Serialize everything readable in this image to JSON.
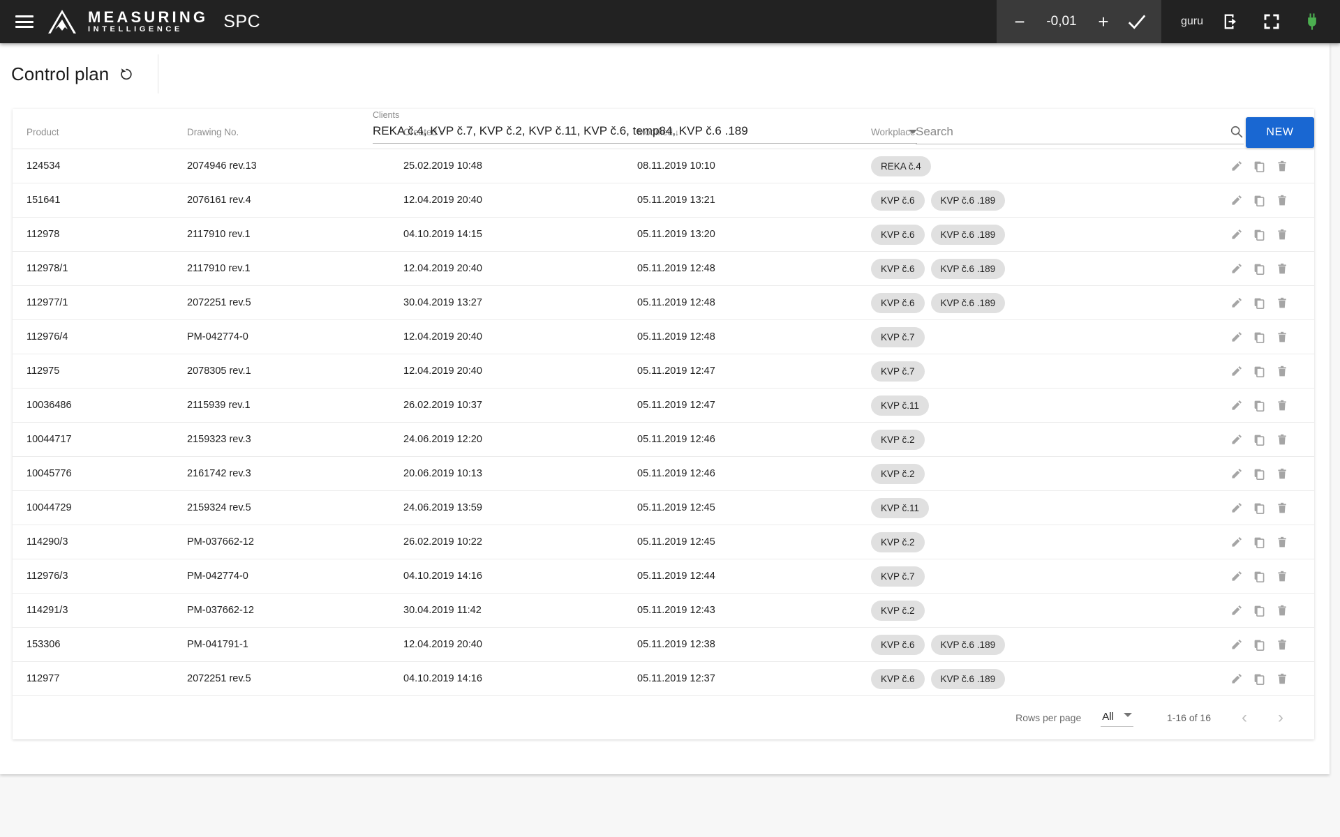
{
  "appbar": {
    "menu_icon": "hamburger-icon",
    "brand_line1": "MEASURING",
    "brand_line2": "INTELLIGENCE",
    "app_subtitle": "SPC",
    "zoom": {
      "minus_label": "−",
      "value": "-0,01",
      "plus_label": "+",
      "confirm_icon": "check-icon"
    },
    "user": "guru",
    "logout_icon": "logout-icon",
    "fullscreen_icon": "fullscreen-icon",
    "connection_icon": "plug-icon",
    "connection_color": "#4caf50",
    "background": "#222222",
    "zoom_group_background": "#3a3a3a"
  },
  "toolbar": {
    "title": "Control plan",
    "refresh_icon": "restore-icon",
    "clients": {
      "label": "Clients",
      "value": "REKA č.4, KVP č.7, KVP č.2, KVP č.11, KVP č.6, temp84, KVP č.6 .189"
    },
    "search": {
      "placeholder": "Search",
      "value": "",
      "icon": "search-icon"
    },
    "new_button": "NEW",
    "accent_color": "#1967d2"
  },
  "table": {
    "columns": [
      {
        "key": "product",
        "label": "Product",
        "sort": ""
      },
      {
        "key": "drawing",
        "label": "Drawing No.",
        "sort": ""
      },
      {
        "key": "created",
        "label": "Created",
        "sort": "↑"
      },
      {
        "key": "modified",
        "label": "Modified",
        "sort": "↓"
      },
      {
        "key": "workplace",
        "label": "Workplace",
        "sort": ""
      }
    ],
    "row_actions": [
      "edit-icon",
      "copy-icon",
      "delete-icon"
    ],
    "rows": [
      {
        "product": "124534",
        "drawing": "2074946 rev.13",
        "created": "25.02.2019 10:48",
        "modified": "08.11.2019 10:10",
        "workplace": [
          "REKA č.4"
        ]
      },
      {
        "product": "151641",
        "drawing": "2076161 rev.4",
        "created": "12.04.2019 20:40",
        "modified": "05.11.2019 13:21",
        "workplace": [
          "KVP č.6",
          "KVP č.6 .189"
        ]
      },
      {
        "product": "112978",
        "drawing": "2117910 rev.1",
        "created": "04.10.2019 14:15",
        "modified": "05.11.2019 13:20",
        "workplace": [
          "KVP č.6",
          "KVP č.6 .189"
        ]
      },
      {
        "product": "112978/1",
        "drawing": "2117910 rev.1",
        "created": "12.04.2019 20:40",
        "modified": "05.11.2019 12:48",
        "workplace": [
          "KVP č.6",
          "KVP č.6 .189"
        ]
      },
      {
        "product": "112977/1",
        "drawing": "2072251 rev.5",
        "created": "30.04.2019 13:27",
        "modified": "05.11.2019 12:48",
        "workplace": [
          "KVP č.6",
          "KVP č.6 .189"
        ]
      },
      {
        "product": "112976/4",
        "drawing": "PM-042774-0",
        "created": "12.04.2019 20:40",
        "modified": "05.11.2019 12:48",
        "workplace": [
          "KVP č.7"
        ]
      },
      {
        "product": "112975",
        "drawing": "2078305 rev.1",
        "created": "12.04.2019 20:40",
        "modified": "05.11.2019 12:47",
        "workplace": [
          "KVP č.7"
        ]
      },
      {
        "product": "10036486",
        "drawing": "2115939 rev.1",
        "created": "26.02.2019 10:37",
        "modified": "05.11.2019 12:47",
        "workplace": [
          "KVP č.11"
        ]
      },
      {
        "product": "10044717",
        "drawing": "2159323 rev.3",
        "created": "24.06.2019 12:20",
        "modified": "05.11.2019 12:46",
        "workplace": [
          "KVP č.2"
        ]
      },
      {
        "product": "10045776",
        "drawing": "2161742 rev.3",
        "created": "20.06.2019 10:13",
        "modified": "05.11.2019 12:46",
        "workplace": [
          "KVP č.2"
        ]
      },
      {
        "product": "10044729",
        "drawing": "2159324 rev.5",
        "created": "24.06.2019 13:59",
        "modified": "05.11.2019 12:45",
        "workplace": [
          "KVP č.11"
        ]
      },
      {
        "product": "114290/3",
        "drawing": "PM-037662-12",
        "created": "26.02.2019 10:22",
        "modified": "05.11.2019 12:45",
        "workplace": [
          "KVP č.2"
        ]
      },
      {
        "product": "112976/3",
        "drawing": "PM-042774-0",
        "created": "04.10.2019 14:16",
        "modified": "05.11.2019 12:44",
        "workplace": [
          "KVP č.7"
        ]
      },
      {
        "product": "114291/3",
        "drawing": "PM-037662-12",
        "created": "30.04.2019 11:42",
        "modified": "05.11.2019 12:43",
        "workplace": [
          "KVP č.2"
        ]
      },
      {
        "product": "153306",
        "drawing": "PM-041791-1",
        "created": "12.04.2019 20:40",
        "modified": "05.11.2019 12:38",
        "workplace": [
          "KVP č.6",
          "KVP č.6 .189"
        ]
      },
      {
        "product": "112977",
        "drawing": "2072251 rev.5",
        "created": "04.10.2019 14:16",
        "modified": "05.11.2019 12:37",
        "workplace": [
          "KVP č.6",
          "KVP č.6 .189"
        ]
      }
    ]
  },
  "paginator": {
    "rows_per_page_label": "Rows per page",
    "rows_per_page_value": "All",
    "range": "1-16 of 16",
    "prev_icon": "chevron-left-icon",
    "next_icon": "chevron-right-icon"
  }
}
